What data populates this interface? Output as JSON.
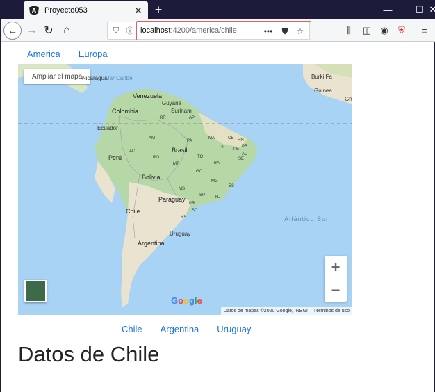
{
  "browser": {
    "tab_title": "Proyecto053",
    "favicon_letter": "A",
    "url_host": "localhost",
    "url_path": ":4200/america/chile",
    "more_label": "•••"
  },
  "nav": {
    "regions": [
      "America",
      "Europa"
    ],
    "countries": [
      "Chile",
      "Argentina",
      "Uruguay"
    ]
  },
  "map": {
    "expand_label": "Ampliar el mapa",
    "labels": {
      "nicaragua": "Nicaragua",
      "mar_caribe": "Mar Caribe",
      "venezuela": "Venezuela",
      "guyana": "Guyana",
      "surinam": "Surinam",
      "colombia": "Colombia",
      "ecuador": "Ecuador",
      "peru": "Perú",
      "brasil": "Brasil",
      "bolivia": "Bolivia",
      "paraguay": "Paraguay",
      "chile": "Chile",
      "uruguay": "Uruguay",
      "argentina": "Argentina",
      "atlantico": "Atlántico Sur",
      "burkina": "Burki Fa",
      "guinea": "Guinea",
      "gh": "Gh",
      "rr": "RR",
      "ap": "AP",
      "am": "AM",
      "pa": "PA",
      "ma": "MA",
      "ce": "CE",
      "rn": "RN",
      "pb": "PB",
      "pi": "PI",
      "pe": "PE",
      "al": "AL",
      "se": "SE",
      "ac": "AC",
      "ro": "RO",
      "to": "TO",
      "ba": "BA",
      "mt": "MT",
      "go": "GO",
      "mg": "MG",
      "es": "ES",
      "ms": "MS",
      "sp": "SP",
      "rj": "RJ",
      "pr": "PR",
      "sc": "SC",
      "rs": "RS"
    },
    "google": "Google",
    "attribution": "Datos de mapas ©2020 Google, INEGI",
    "terms": "Términos de uso"
  },
  "page": {
    "heading": "Datos de Chile"
  },
  "colors": {
    "link": "#1a73e8",
    "ocean": "#a9d3f5",
    "land_green": "#b5d8a6",
    "land_tan": "#e9e3cf",
    "titlebar": "#1c1b3a"
  }
}
